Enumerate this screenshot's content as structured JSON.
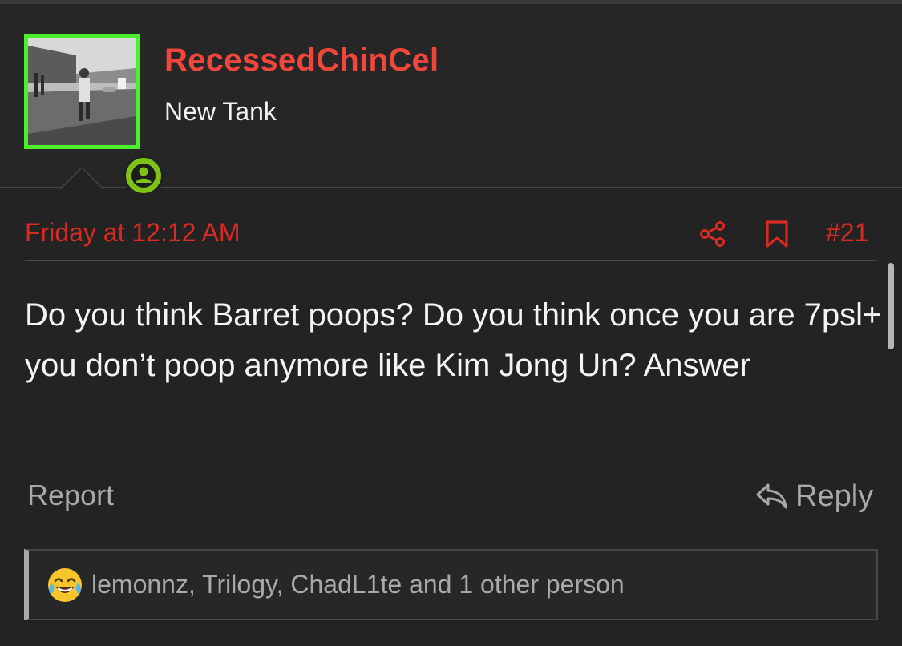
{
  "colors": {
    "background": "#232323",
    "username": "#f0463b",
    "meta_red": "#d62a22",
    "avatar_border": "#4cf02a",
    "online_badge": "#7dc316",
    "muted_text": "#a8a8a8"
  },
  "user": {
    "name": "RecessedChinCel",
    "title": "New Tank",
    "avatar_icon": "user-avatar-photo",
    "status_icon": "online-person-icon"
  },
  "post": {
    "date": "Friday at 12:12 AM",
    "number": "#21",
    "share_icon": "share-icon",
    "bookmark_icon": "bookmark-icon",
    "body": "Do you think Barret poops? Do you think once you are 7psl+ you don’t poop anymore like Kim Jong Un? Answer"
  },
  "actions": {
    "report_label": "Report",
    "reply_label": "Reply",
    "reply_icon": "reply-arrow-icon"
  },
  "reactions": {
    "emoji_icon": "tears-of-joy-emoji-icon",
    "summary": "lemonnz, Trilogy, ChadL1te and 1 other person"
  }
}
